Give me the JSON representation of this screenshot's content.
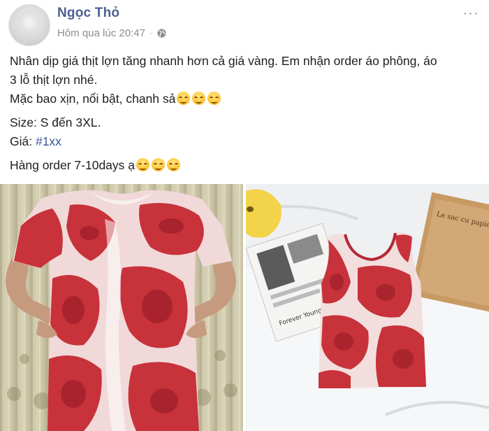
{
  "post": {
    "author": "Ngọc Thỏ",
    "timestamp": "Hôm qua lúc 20:47",
    "separator": "·",
    "privacy_icon": "globe-icon",
    "more_icon": "more-options-icon",
    "more_label": "···",
    "text": {
      "line1": "Nhân dịp giá thịt lợn tăng nhanh hơn cả giá vàng. Em nhận order áo phông, áo",
      "line2": "3 lỗ thịt lợn nhé.",
      "line3": "Mặc bao xịn, nổi bật, chanh sả",
      "size": "Size: S đến 3XL.",
      "price_label": "Giá: ",
      "price_tag": "#1xx",
      "order": "Hàng order 7-10days ạ"
    }
  },
  "photos": [
    {
      "label": "meat-print-tshirt-photo",
      "magazine_text": ""
    },
    {
      "label": "meat-print-tanktop-photo",
      "magazine_text": "Forever Young",
      "book_text": "Le sac cu papier"
    }
  ],
  "colors": {
    "author": "#4b5f8f",
    "hashtag": "#385898",
    "meta": "#8a8d91",
    "meat_red": "#c8323a"
  }
}
